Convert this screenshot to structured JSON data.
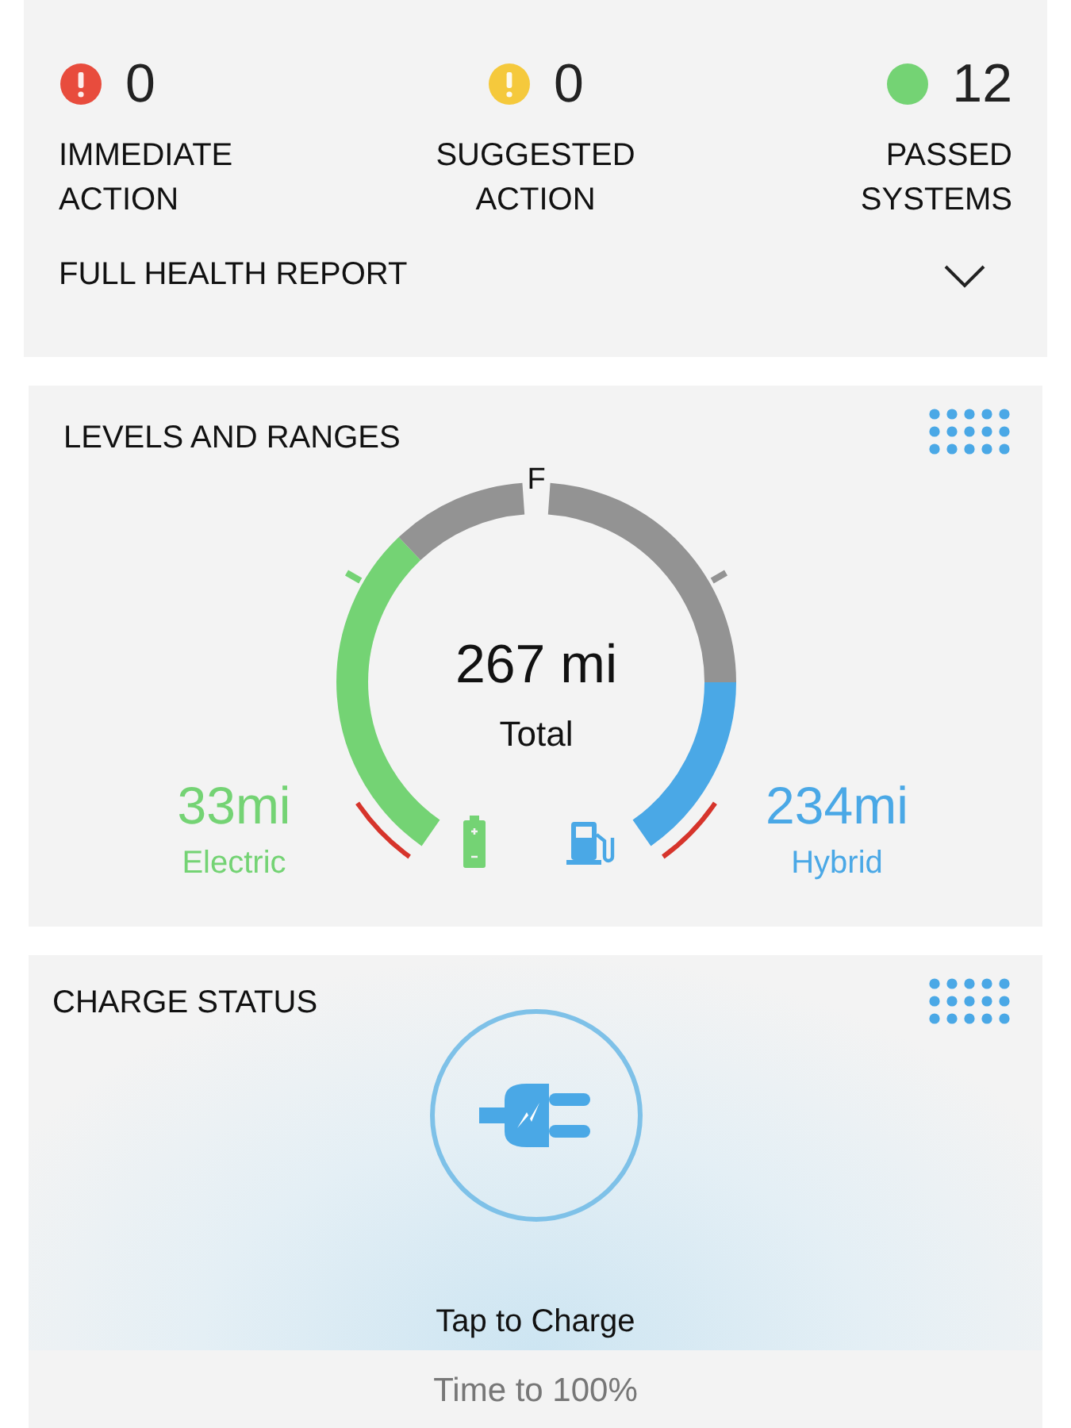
{
  "status": [
    {
      "kind": "alert",
      "count": "0",
      "label": "IMMEDIATE ACTION",
      "color": "#e84c3d"
    },
    {
      "kind": "alert",
      "count": "0",
      "label": "SUGGESTED ACTION",
      "color": "#f5c93c"
    },
    {
      "kind": "ok",
      "count": "12",
      "label": "PASSED SYSTEMS",
      "color": "#74d374"
    }
  ],
  "health_report": {
    "label": "FULL HEALTH REPORT",
    "expanded": false
  },
  "levels": {
    "title": "LEVELS AND RANGES",
    "gauge_mark": "F",
    "total": "267 mi",
    "total_label": "Total",
    "electric": {
      "range": "33mi",
      "label": "Electric"
    },
    "hybrid": {
      "range": "234mi",
      "label": "Hybrid"
    }
  },
  "charge": {
    "title": "CHARGE STATUS",
    "action": "Tap to Charge",
    "time_label": "Time to 100%"
  }
}
